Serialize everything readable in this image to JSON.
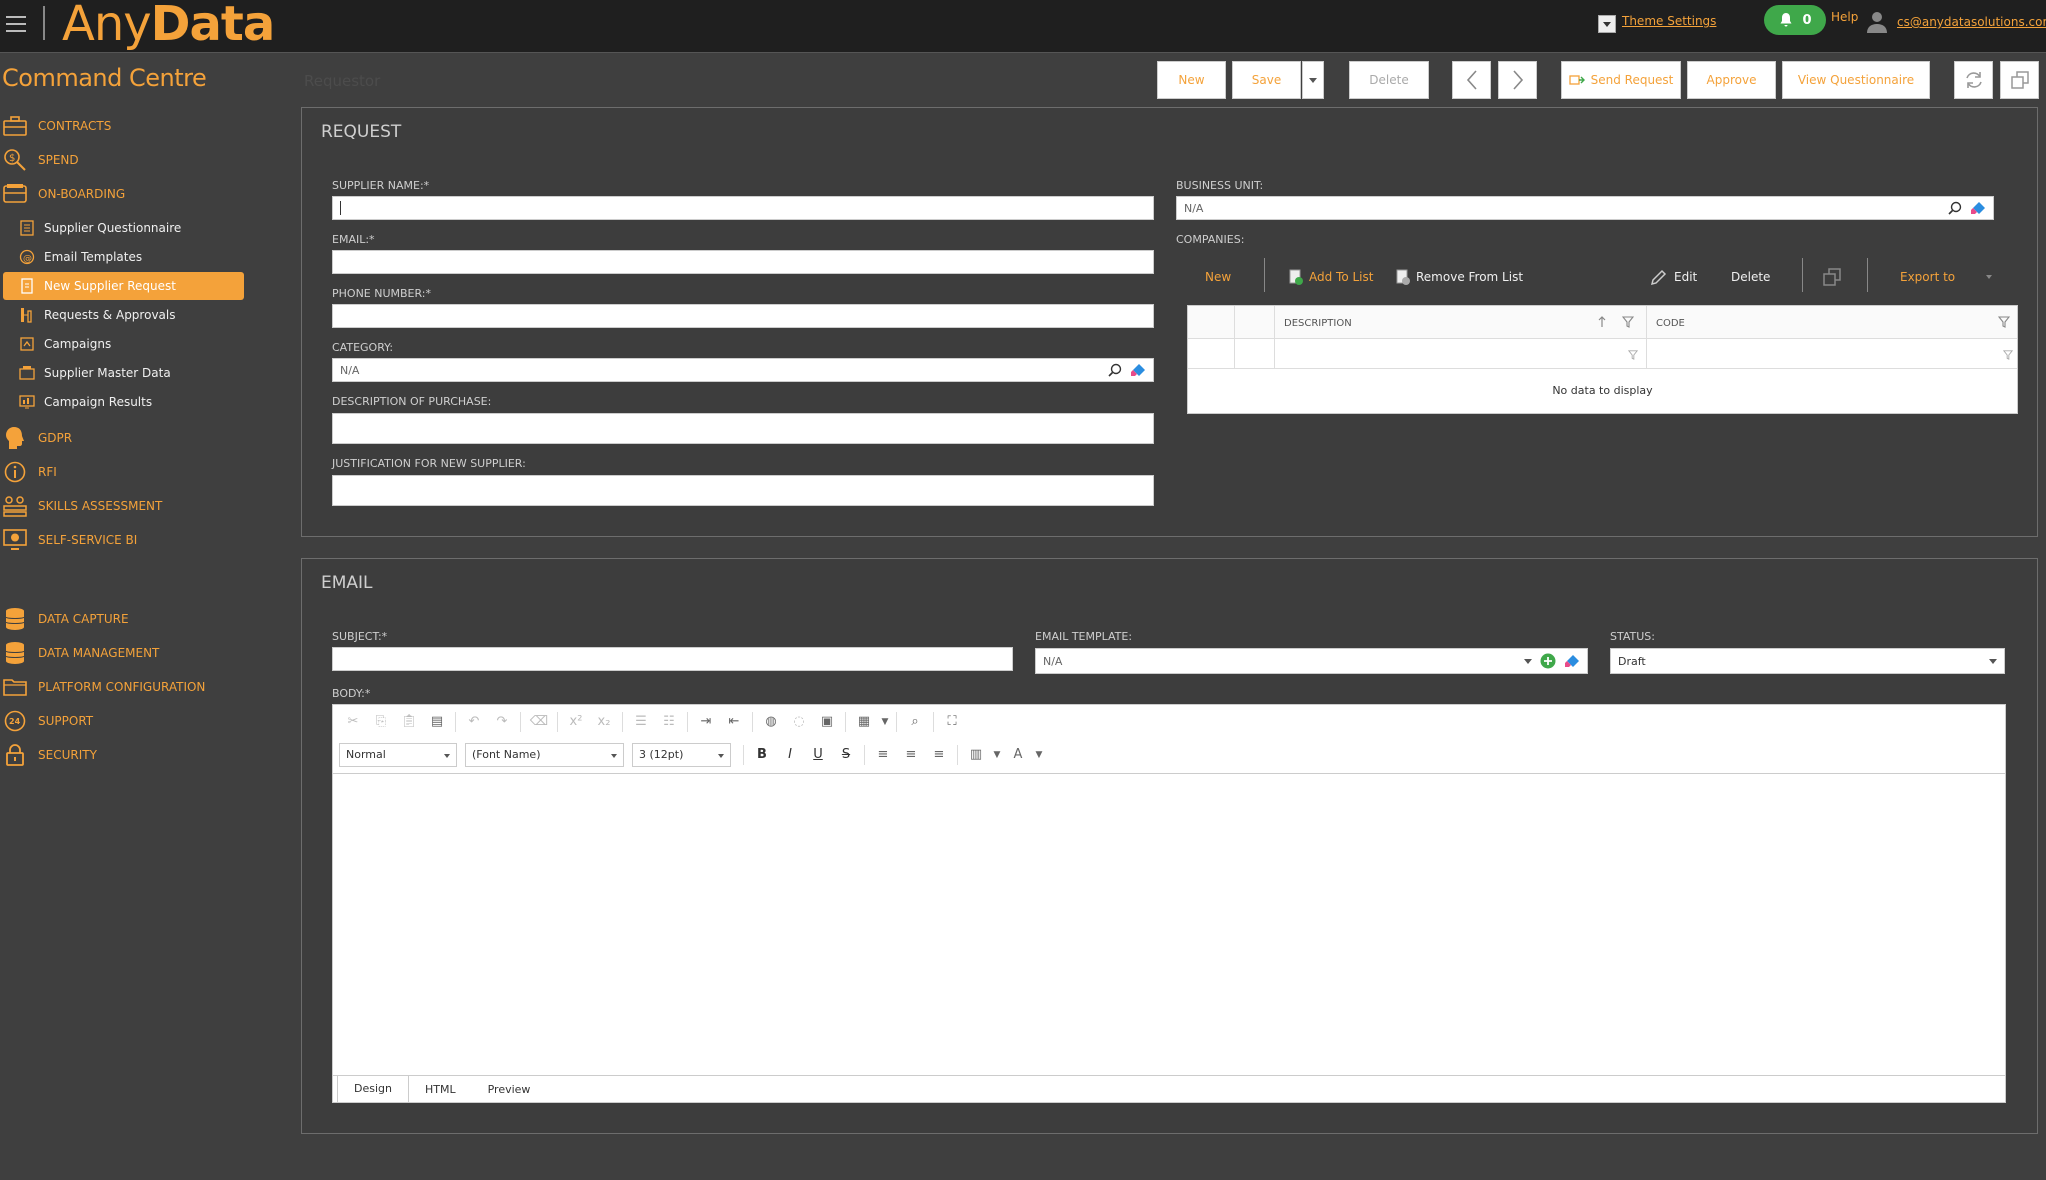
{
  "header": {
    "logo_any": "Any",
    "logo_data": "Data",
    "theme_settings": "Theme Settings",
    "notifications_count": "0",
    "help": "Help",
    "user_email": "cs@anydatasolutions.com"
  },
  "sidebar": {
    "title": "Command Centre",
    "items": [
      {
        "label": "CONTRACTS",
        "icon": "briefcase-icon"
      },
      {
        "label": "SPEND",
        "icon": "coin-search-icon"
      },
      {
        "label": "ON-BOARDING",
        "icon": "truck-icon"
      },
      {
        "label": "GDPR",
        "icon": "head-icon"
      },
      {
        "label": "RFI",
        "icon": "info-icon"
      },
      {
        "label": "SKILLS ASSESSMENT",
        "icon": "people-icon"
      },
      {
        "label": "SELF-SERVICE BI",
        "icon": "monitor-chart-icon"
      },
      {
        "label": "DATA CAPTURE",
        "icon": "database-icon"
      },
      {
        "label": "DATA MANAGEMENT",
        "icon": "database-stack-icon"
      },
      {
        "label": "PLATFORM CONFIGURATION",
        "icon": "folder-icon"
      },
      {
        "label": "SUPPORT",
        "icon": "support-24-icon"
      },
      {
        "label": "SECURITY",
        "icon": "lock-icon"
      }
    ],
    "onboarding_sub": [
      {
        "label": "Supplier Questionnaire"
      },
      {
        "label": "Email Templates"
      },
      {
        "label": "New Supplier Request"
      },
      {
        "label": "Requests & Approvals"
      },
      {
        "label": "Campaigns"
      },
      {
        "label": "Supplier Master Data"
      },
      {
        "label": "Campaign Results"
      }
    ]
  },
  "toolbar": {
    "breadcrumb": "Requestor",
    "new": "New",
    "save": "Save",
    "delete": "Delete",
    "send_request": "Send Request",
    "approve": "Approve",
    "view_questionnaire": "View Questionnaire"
  },
  "request": {
    "title": "REQUEST",
    "supplier_name_label": "SUPPLIER NAME:*",
    "email_label": "EMAIL:*",
    "phone_label": "PHONE NUMBER:*",
    "category_label": "CATEGORY:",
    "category_value": "N/A",
    "description_label": "DESCRIPTION OF PURCHASE:",
    "justification_label": "JUSTIFICATION FOR NEW SUPPLIER:",
    "business_unit_label": "BUSINESS UNIT:",
    "business_unit_value": "N/A",
    "companies_label": "COMPANIES:",
    "companies_toolbar": {
      "new": "New",
      "add_to_list": "Add To List",
      "remove_from_list": "Remove From List",
      "edit": "Edit",
      "delete": "Delete",
      "export_to": "Export to"
    },
    "grid": {
      "columns": [
        "DESCRIPTION",
        "CODE"
      ],
      "empty_text": "No data to display"
    }
  },
  "email": {
    "title": "EMAIL",
    "subject_label": "SUBJECT:*",
    "template_label": "EMAIL TEMPLATE:",
    "template_value": "N/A",
    "status_label": "STATUS:",
    "status_value": "Draft",
    "body_label": "BODY:*",
    "editor": {
      "paragraph_style": "Normal",
      "font_name": "(Font Name)",
      "font_size": "3 (12pt)",
      "tabs": [
        "Design",
        "HTML",
        "Preview"
      ]
    }
  },
  "colors": {
    "accent": "#f4a23a",
    "topbar": "#1f1f1f",
    "background": "#3f3f3f",
    "notification": "#3fa84a"
  }
}
